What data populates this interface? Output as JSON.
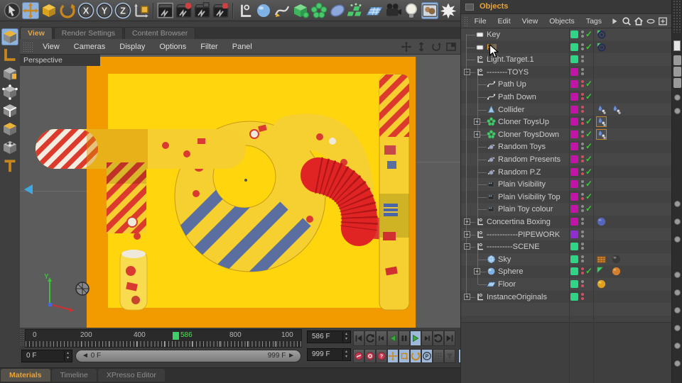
{
  "colors": {
    "accent": "#E8A33D",
    "selection": "#8FB3DC",
    "check_green": "#3DC43D",
    "layer_green": "#2FD486",
    "layer_magenta": "#C214A6",
    "layer_purple": "#8F2FD0",
    "canvas_yellow": "#FFD60D",
    "canvas_orange": "#F29B00",
    "tube_red": "#E02424",
    "stripe_blue": "#5A6FA0",
    "marker_green": "#3FCF69"
  },
  "glyphs": {
    "left": "◄",
    "right": "►",
    "step_up": "▴",
    "step_down": "▾"
  },
  "top_toolbar": {
    "icons": [
      {
        "name": "select-tool-icon"
      },
      {
        "name": "move-tool-icon",
        "active": true
      },
      {
        "name": "scale-tool-icon"
      },
      {
        "name": "rotate-tool-icon"
      },
      {
        "name": "lock-x-icon",
        "letter": "X"
      },
      {
        "name": "lock-y-icon",
        "letter": "Y"
      },
      {
        "name": "lock-z-icon",
        "letter": "Z"
      },
      {
        "name": "coordinate-system-icon"
      },
      {
        "name": "render-view-icon"
      },
      {
        "name": "render-picture-viewer-icon"
      },
      {
        "name": "render-team-icon"
      },
      {
        "name": "render-settings-icon"
      },
      {
        "name": "null-object-icon"
      },
      {
        "name": "primitive-object-icon"
      },
      {
        "name": "spline-pen-icon"
      },
      {
        "name": "generator-icon"
      },
      {
        "name": "mograph-cloner-icon"
      },
      {
        "name": "metaball-icon"
      },
      {
        "name": "field-icon"
      },
      {
        "name": "floor-object-icon"
      },
      {
        "name": "camera-object-icon"
      },
      {
        "name": "light-object-icon"
      },
      {
        "name": "sky-object-icon",
        "active": true
      },
      {
        "name": "background-object-icon"
      }
    ]
  },
  "left_toolbar": {
    "icons": [
      {
        "name": "make-editable-icon",
        "active": true
      },
      {
        "name": "model-mode-icon"
      },
      {
        "name": "texture-mode-icon"
      },
      {
        "name": "points-mode-icon"
      },
      {
        "name": "edges-mode-icon"
      },
      {
        "name": "polygons-mode-icon"
      },
      {
        "name": "texture-axis-icon"
      },
      {
        "name": "axis-mode-icon"
      }
    ]
  },
  "view_tabs": [
    {
      "label": "View",
      "active": true
    },
    {
      "label": "Render Settings",
      "active": false
    },
    {
      "label": "Content Browser",
      "active": false
    }
  ],
  "viewport": {
    "menu": [
      "View",
      "Cameras",
      "Display",
      "Options",
      "Filter",
      "Panel"
    ],
    "nav_icons": [
      "pan-icon",
      "dolly-icon",
      "orbit-icon",
      "toggle-view-icon"
    ],
    "camera_label": "Perspective",
    "axis_label": "Y"
  },
  "timeline": {
    "ruler_labels": [
      "0",
      "200",
      "400",
      "800",
      "100"
    ],
    "current_frame": "586",
    "fields": {
      "current": "586 F",
      "end": "999 F",
      "start": "0 F"
    },
    "range": {
      "start": "0 F",
      "end": "999 F"
    },
    "transport": [
      {
        "name": "goto-start-button"
      },
      {
        "name": "previous-key-button"
      },
      {
        "name": "previous-frame-button"
      },
      {
        "name": "play-backwards-button"
      },
      {
        "name": "stop-button"
      },
      {
        "name": "play-forwards-button",
        "active": true
      },
      {
        "name": "next-frame-button"
      },
      {
        "name": "loop-button"
      },
      {
        "name": "goto-end-button"
      }
    ],
    "record": [
      {
        "name": "record-keyframe-button"
      },
      {
        "name": "autokey-button"
      },
      {
        "name": "keyframe-selection-button"
      },
      {
        "name": "record-position-button",
        "active": true
      },
      {
        "name": "record-scale-button",
        "active": true
      },
      {
        "name": "record-rotation-button",
        "active": true
      },
      {
        "name": "record-parameter-button",
        "active": true
      },
      {
        "name": "record-pla-button"
      },
      {
        "name": "keyframe-presets-button"
      },
      {
        "name": "solo-button",
        "active": true
      }
    ]
  },
  "bottom_tabs": [
    {
      "label": "Materials",
      "active": true
    },
    {
      "label": "Timeline",
      "active": false
    },
    {
      "label": "XPresso Editor",
      "active": false
    }
  ],
  "objects_panel": {
    "title": "Objects",
    "menu": [
      "File",
      "Edit",
      "View",
      "Objects",
      "Tags"
    ],
    "menu_icons": [
      "submenu-arrow-icon",
      "search-icon",
      "home-icon",
      "layer-filter-icon",
      "add-panel-icon"
    ],
    "tree": [
      {
        "label": "Key",
        "icon": "light-icon",
        "depth": 0,
        "expand": null,
        "layer": "green",
        "dots": [
          "gray",
          "gray"
        ],
        "check": true,
        "selected": false,
        "tags": [
          "target-tag"
        ]
      },
      {
        "label": "Fill",
        "icon": "light-icon",
        "depth": 0,
        "expand": null,
        "layer": "green",
        "dots": [
          "gray",
          "gray"
        ],
        "check": true,
        "selected": true,
        "tags": [
          "target-tag"
        ]
      },
      {
        "label": "Light.Target.1",
        "icon": "null-icon",
        "depth": 0,
        "expand": null,
        "layer": "green",
        "dots": [
          "gray",
          "gray"
        ],
        "check": false,
        "selected": false,
        "tags": []
      },
      {
        "label": "--------TOYS",
        "icon": "null-icon",
        "depth": 0,
        "expand": "-",
        "layer": "magenta",
        "dots": [
          "gray",
          "gray"
        ],
        "check": false,
        "selected": false,
        "tags": []
      },
      {
        "label": "Path Up",
        "icon": "spline-icon",
        "depth": 1,
        "expand": null,
        "layer": "magenta",
        "dots": [
          "red",
          "red"
        ],
        "check": true,
        "selected": false,
        "tags": []
      },
      {
        "label": "Path Down",
        "icon": "spline-icon",
        "depth": 1,
        "expand": null,
        "layer": "magenta",
        "dots": [
          "red",
          "red"
        ],
        "check": true,
        "selected": false,
        "tags": []
      },
      {
        "label": "Collider",
        "icon": "collider-icon",
        "depth": 1,
        "expand": null,
        "layer": "magenta",
        "dots": [
          "red",
          "red"
        ],
        "check": false,
        "selected": false,
        "tags": [
          "dynamics-tag",
          "dynamics-tag"
        ]
      },
      {
        "label": "Cloner ToysUp",
        "icon": "cloner-icon",
        "depth": 1,
        "expand": "+",
        "layer": "magenta",
        "dots": [
          "gray",
          "red"
        ],
        "check": true,
        "selected": false,
        "tags": [
          "dynamics-tag-framed"
        ]
      },
      {
        "label": "Cloner ToysDown",
        "icon": "cloner-icon",
        "depth": 1,
        "expand": "+",
        "layer": "magenta",
        "dots": [
          "gray",
          "red"
        ],
        "check": true,
        "selected": false,
        "tags": [
          "dynamics-tag-framed"
        ]
      },
      {
        "label": "Random Toys",
        "icon": "effector-icon",
        "depth": 1,
        "expand": null,
        "layer": "magenta",
        "dots": [
          "gray",
          "gray"
        ],
        "check": true,
        "selected": false,
        "tags": []
      },
      {
        "label": "Random Presents",
        "icon": "effector-icon",
        "depth": 1,
        "expand": null,
        "layer": "magenta",
        "dots": [
          "red",
          "red"
        ],
        "check": true,
        "selected": false,
        "tags": []
      },
      {
        "label": "Random P.Z",
        "icon": "effector-icon",
        "depth": 1,
        "expand": null,
        "layer": "magenta",
        "dots": [
          "gray",
          "red"
        ],
        "check": true,
        "selected": false,
        "tags": []
      },
      {
        "label": "Plain Visibility",
        "icon": "plain-effector-icon",
        "depth": 1,
        "expand": null,
        "layer": "magenta",
        "dots": [
          "gray",
          "gray"
        ],
        "check": true,
        "selected": false,
        "tags": []
      },
      {
        "label": "Plain Visibility Top",
        "icon": "plain-effector-icon",
        "depth": 1,
        "expand": null,
        "layer": "magenta",
        "dots": [
          "gray",
          "red"
        ],
        "check": true,
        "selected": false,
        "tags": []
      },
      {
        "label": "Plain Toy colour",
        "icon": "plain-effector-icon",
        "depth": 1,
        "expand": null,
        "layer": "magenta",
        "dots": [
          "gray",
          "gray"
        ],
        "check": true,
        "selected": false,
        "tags": []
      },
      {
        "label": "Concertina Boxing",
        "icon": "null-icon",
        "depth": 0,
        "expand": "+",
        "layer": "magenta",
        "dots": [
          "gray",
          "gray"
        ],
        "check": false,
        "selected": false,
        "tags": [
          "material-blue-tag"
        ]
      },
      {
        "label": "------------PIPEWORK",
        "icon": "null-icon",
        "depth": 0,
        "expand": "+",
        "layer": "purple",
        "dots": [
          "gray",
          "gray"
        ],
        "check": false,
        "selected": false,
        "tags": []
      },
      {
        "label": "----------SCENE",
        "icon": "null-icon",
        "depth": 0,
        "expand": "-",
        "layer": "green",
        "dots": [
          "gray",
          "gray"
        ],
        "check": false,
        "selected": false,
        "tags": []
      },
      {
        "label": "Sky",
        "icon": "sky-icon",
        "depth": 1,
        "expand": null,
        "layer": "green",
        "dots": [
          "gray",
          "gray"
        ],
        "check": false,
        "selected": false,
        "tags": [
          "compositing-tag",
          "material-dark-tag"
        ]
      },
      {
        "label": "Sphere",
        "icon": "sphere-icon",
        "depth": 1,
        "expand": "+",
        "layer": "green",
        "dots": [
          "red",
          "red"
        ],
        "check": true,
        "selected": false,
        "tags": [
          "phong-tag",
          "material-orange-tag"
        ]
      },
      {
        "label": "Floor",
        "icon": "floor-icon",
        "depth": 1,
        "expand": null,
        "layer": "green",
        "dots": [
          "gray",
          "red"
        ],
        "check": false,
        "selected": false,
        "tags": [
          "material-yellow-tag"
        ]
      },
      {
        "label": "InstanceOriginals",
        "icon": "null-icon",
        "depth": 0,
        "expand": "+",
        "layer": "green",
        "dots": [
          "red",
          "red"
        ],
        "check": false,
        "selected": false,
        "tags": []
      }
    ]
  }
}
